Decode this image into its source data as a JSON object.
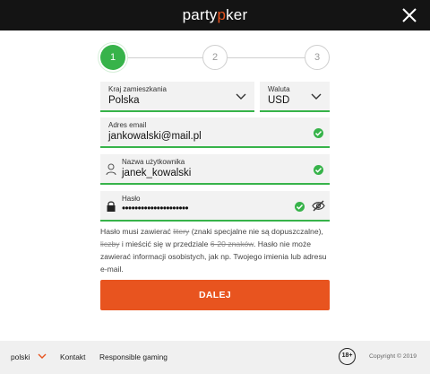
{
  "header": {
    "logo_part1": "party",
    "logo_accent": "p",
    "logo_part2": "ker",
    "logo_accent_color": "#e8541f"
  },
  "stepper": {
    "steps": [
      "1",
      "2",
      "3"
    ],
    "active_step": 1,
    "active_color": "#37b34a"
  },
  "form": {
    "country": {
      "label": "Kraj zamieszkania",
      "value": "Polska"
    },
    "currency": {
      "label": "Waluta",
      "value": "USD"
    },
    "email": {
      "label": "Adres email",
      "value": "jankowalski@mail.pl"
    },
    "username": {
      "label": "Nazwa użytkownika",
      "value": "janek_kowalski"
    },
    "password": {
      "label": "Hasło",
      "value": "•••••••••••••••••••••"
    }
  },
  "hint": {
    "part1": "Hasło musi zawierać ",
    "strike1": "litery",
    "part2": " (znaki specjalne nie są dopuszczalne), ",
    "strike2": "liczby",
    "part3": " i mieścić się w przedziale ",
    "strike3": "6-20 znaków",
    "part4": ". Hasło nie może zawierać informacji osobistych, jak np. Twojego imienia lub adresu e-mail."
  },
  "cta": {
    "label": "DALEJ",
    "color": "#e8541f"
  },
  "footer": {
    "language": "polski",
    "contact": "Kontakt",
    "responsible": "Responsible gaming",
    "age_badge": "18+",
    "copyright": "Copyright © 2019"
  },
  "icons": [
    "close-icon",
    "chevron-down-icon",
    "check-icon",
    "user-icon",
    "lock-icon",
    "eye-off-icon"
  ]
}
